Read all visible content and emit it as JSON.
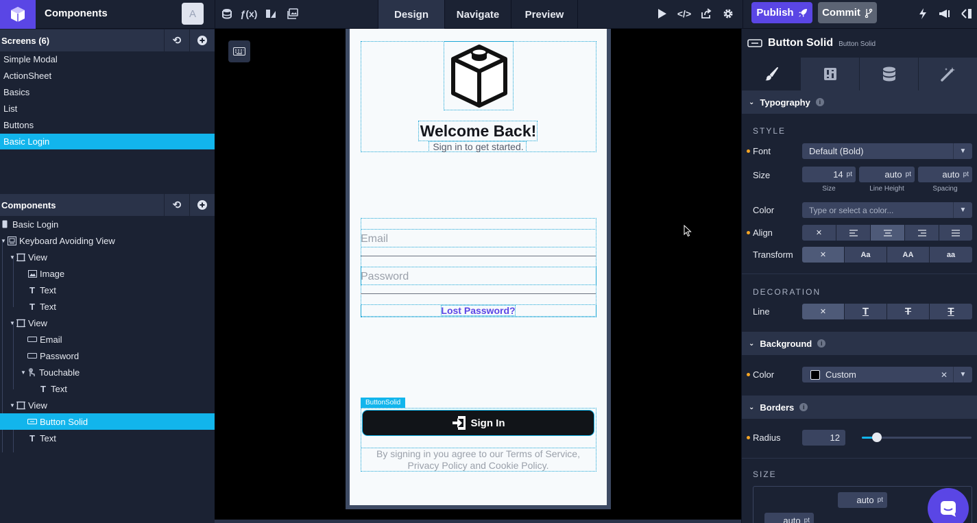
{
  "app": {
    "title": "Components",
    "avatar_initial": "A"
  },
  "toolbar": {
    "modes": [
      "Design",
      "Navigate",
      "Preview"
    ],
    "active_mode": "Design",
    "publish_label": "Publish",
    "commit_label": "Commit"
  },
  "screens": {
    "header": "Screens (6)",
    "items": [
      "Simple Modal",
      "ActionSheet",
      "Basics",
      "List",
      "Buttons",
      "Basic Login"
    ],
    "active": "Basic Login"
  },
  "components": {
    "header": "Components",
    "tree": [
      {
        "label": "Basic Login",
        "icon": "screen-icon",
        "depth": 0
      },
      {
        "label": "Keyboard Avoiding View",
        "icon": "keyboard-view-icon",
        "depth": 0,
        "caret": true
      },
      {
        "label": "View",
        "icon": "view-icon",
        "depth": 1,
        "caret": true
      },
      {
        "label": "Image",
        "icon": "image-icon",
        "depth": 2
      },
      {
        "label": "Text",
        "icon": "text-icon",
        "depth": 2
      },
      {
        "label": "Text",
        "icon": "text-icon",
        "depth": 2
      },
      {
        "label": "View",
        "icon": "view-icon",
        "depth": 1,
        "caret": true
      },
      {
        "label": "Email",
        "icon": "input-icon",
        "depth": 2
      },
      {
        "label": "Password",
        "icon": "input-icon",
        "depth": 2
      },
      {
        "label": "Touchable",
        "icon": "touchable-icon",
        "depth": 2,
        "caret": true
      },
      {
        "label": "Text",
        "icon": "text-icon",
        "depth": 3
      },
      {
        "label": "View",
        "icon": "view-icon",
        "depth": 1,
        "caret": true
      },
      {
        "label": "Button Solid",
        "icon": "button-icon",
        "depth": 2,
        "active": true
      },
      {
        "label": "Text",
        "icon": "text-icon",
        "depth": 2
      }
    ]
  },
  "preview": {
    "welcome": "Welcome Back!",
    "subtitle": "Sign in to get started.",
    "email_placeholder": "Email",
    "password_placeholder": "Password",
    "lost_password": "Lost Password?",
    "button_tag": "ButtonSolid",
    "signin_label": "Sign In",
    "terms": "By signing in you agree to our Terms of Service, Privacy Policy and Cookie Policy."
  },
  "inspector": {
    "title": "Button Solid",
    "subtitle": "Button Solid",
    "typography": {
      "header": "Typography",
      "style_caption": "STYLE",
      "font_label": "Font",
      "font_value": "Default (Bold)",
      "size_label": "Size",
      "size_value": "14",
      "size_unit": "pt",
      "line_height_value": "auto",
      "spacing_value": "auto",
      "size_caption": "Size",
      "line_height_caption": "Line Height",
      "spacing_caption": "Spacing",
      "color_label": "Color",
      "color_placeholder": "Type or select a color...",
      "align_label": "Align",
      "transform_label": "Transform",
      "transform_options": [
        "Aa",
        "AA",
        "aa"
      ],
      "decoration_caption": "DECORATION",
      "line_label": "Line"
    },
    "background": {
      "header": "Background",
      "color_label": "Color",
      "color_value": "Custom",
      "swatch": "#000000"
    },
    "borders": {
      "header": "Borders",
      "radius_label": "Radius",
      "radius_value": "12",
      "radius_fraction": 0.14
    },
    "size": {
      "caption": "SIZE",
      "top_value": "auto",
      "left_value": "auto",
      "unit": "pt"
    }
  },
  "colors": {
    "accent": "#5a46e5",
    "selection": "#12b5ec",
    "panel": "#1b2233",
    "header": "#2a3349"
  }
}
